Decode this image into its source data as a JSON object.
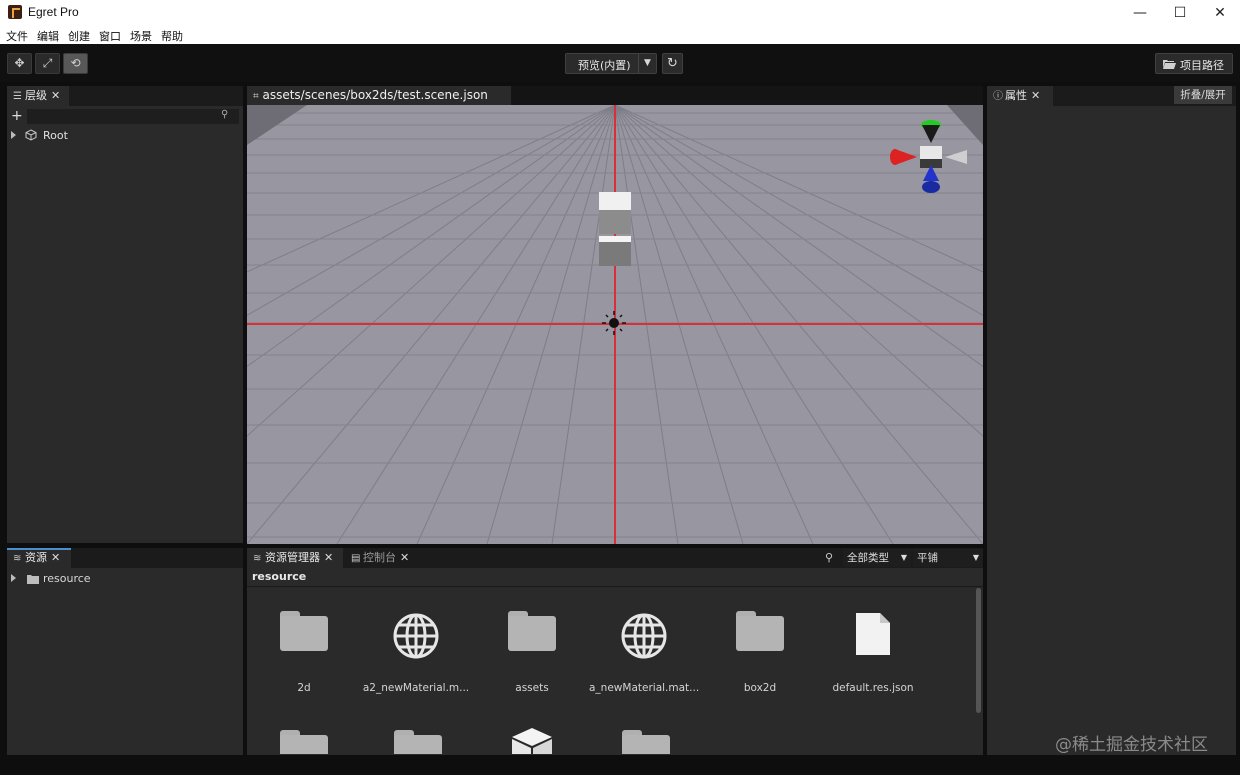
{
  "window": {
    "title": "Egret Pro",
    "controls": {
      "minimize": "—",
      "maximize": "☐",
      "close": "✕"
    }
  },
  "menu": [
    "文件",
    "编辑",
    "创建",
    "窗口",
    "场景",
    "帮助"
  ],
  "toolbar": {
    "preview_label": "预览(内置)",
    "preview_caret": "▼",
    "refresh_glyph": "↻",
    "project_path_label": "项目路径",
    "tool_move": "✥",
    "tool_scale": "⤢",
    "tool_rotate": "⟲"
  },
  "hierarchy": {
    "tab_label": "层级",
    "close": "✕",
    "add": "+",
    "search_placeholder": "",
    "root_label": "Root"
  },
  "scene": {
    "tab_label": "assets/scenes/box2ds/test.scene.json",
    "more": ">>>"
  },
  "properties": {
    "tab_label": "属性",
    "close": "✕",
    "toggle_label": "折叠/展开"
  },
  "resources": {
    "tab_label": "资源",
    "close": "✕",
    "tree_item": "resource"
  },
  "asset_manager": {
    "tabs": [
      {
        "label": "资源管理器",
        "close": "✕"
      },
      {
        "label": "控制台",
        "close": "✕"
      }
    ],
    "type_filter": "全部类型",
    "layout_mode": "平铺",
    "caret": "▼",
    "path": "resource",
    "items": [
      {
        "label": "2d",
        "icon": "folder-icon"
      },
      {
        "label": "a2_newMaterial.m...",
        "icon": "globe-icon"
      },
      {
        "label": "assets",
        "icon": "folder-icon"
      },
      {
        "label": "a_newMaterial.mat...",
        "icon": "globe-icon"
      },
      {
        "label": "box2d",
        "icon": "folder-icon"
      },
      {
        "label": "default.res.json",
        "icon": "file-icon"
      }
    ],
    "row2_icons": [
      "folder-icon",
      "folder-icon",
      "cube-icon",
      "folder-icon"
    ]
  },
  "watermark": "@稀土掘金技术社区",
  "colors": {
    "axis_red": "#d8303a",
    "gizmo_green": "#22cc22",
    "gizmo_red": "#dd2222",
    "gizmo_blue": "#2233cc",
    "floor": "#9896a0"
  }
}
